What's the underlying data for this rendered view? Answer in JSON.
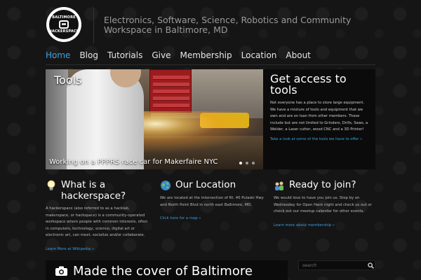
{
  "logo": {
    "top_text": "BALTIMORE",
    "bottom_text": "HACKERSPACE"
  },
  "header": {
    "tagline": "Electronics, Software, Science, Robotics and Community Workspace in Baltimore, MD"
  },
  "nav": {
    "items": [
      {
        "label": "Home",
        "active": true
      },
      {
        "label": "Blog"
      },
      {
        "label": "Tutorials"
      },
      {
        "label": "Give"
      },
      {
        "label": "Membership"
      },
      {
        "label": "Location"
      },
      {
        "label": "About"
      }
    ]
  },
  "slider": {
    "title": "Tools",
    "caption": "Working on a PPPRS race car for Makerfaire NYC",
    "dots": 3,
    "active_dot": 1
  },
  "feature": {
    "title": "Get access to tools",
    "body": "Not everyone has a place to store large equipment. We have a mixture of tools and equipment that we own and are on loan from other members. These include but are not limited to Grinders, Drills, Saws, a Welder, a Laser cutter, wood CNC and a 3D Printer!",
    "link": "Take a look at some of the tools we have to offer »"
  },
  "columns": {
    "hackerspace": {
      "icon": "lightbulb-icon",
      "title": "What is a hackerspace?",
      "body": "A hackerspace (also referred to as a hacklab, makerspace, or hackspace) is a community-operated workspace where people with common interests, often in computers, technology, science, digital art or electronic art, can meet, socialize and/or collaborate.",
      "link": "Learn More at Wikipedia »"
    },
    "location": {
      "icon": "globe-icon",
      "title": "Our Location",
      "body": "We are located at the intersection of Rt. 40 Pulaski Hwy and North Point Blvd in north east Baltimore, MD.",
      "link": "Click here for a map »"
    },
    "join": {
      "icon": "people-icon",
      "title": "Ready to join?",
      "body": "We would love to have you join us. Stop by on Wednesday for Open Hack night and check us out or check out our meetup calendar for other events.",
      "link": "Learn more about membership »"
    }
  },
  "cover": {
    "icon": "camera-icon",
    "title": "Made the cover of Baltimore"
  },
  "search": {
    "placeholder": "search",
    "icon": "search-icon"
  },
  "colors": {
    "accent": "#3aa0e0",
    "background": "#151515",
    "panel": "#0b0b0b"
  }
}
